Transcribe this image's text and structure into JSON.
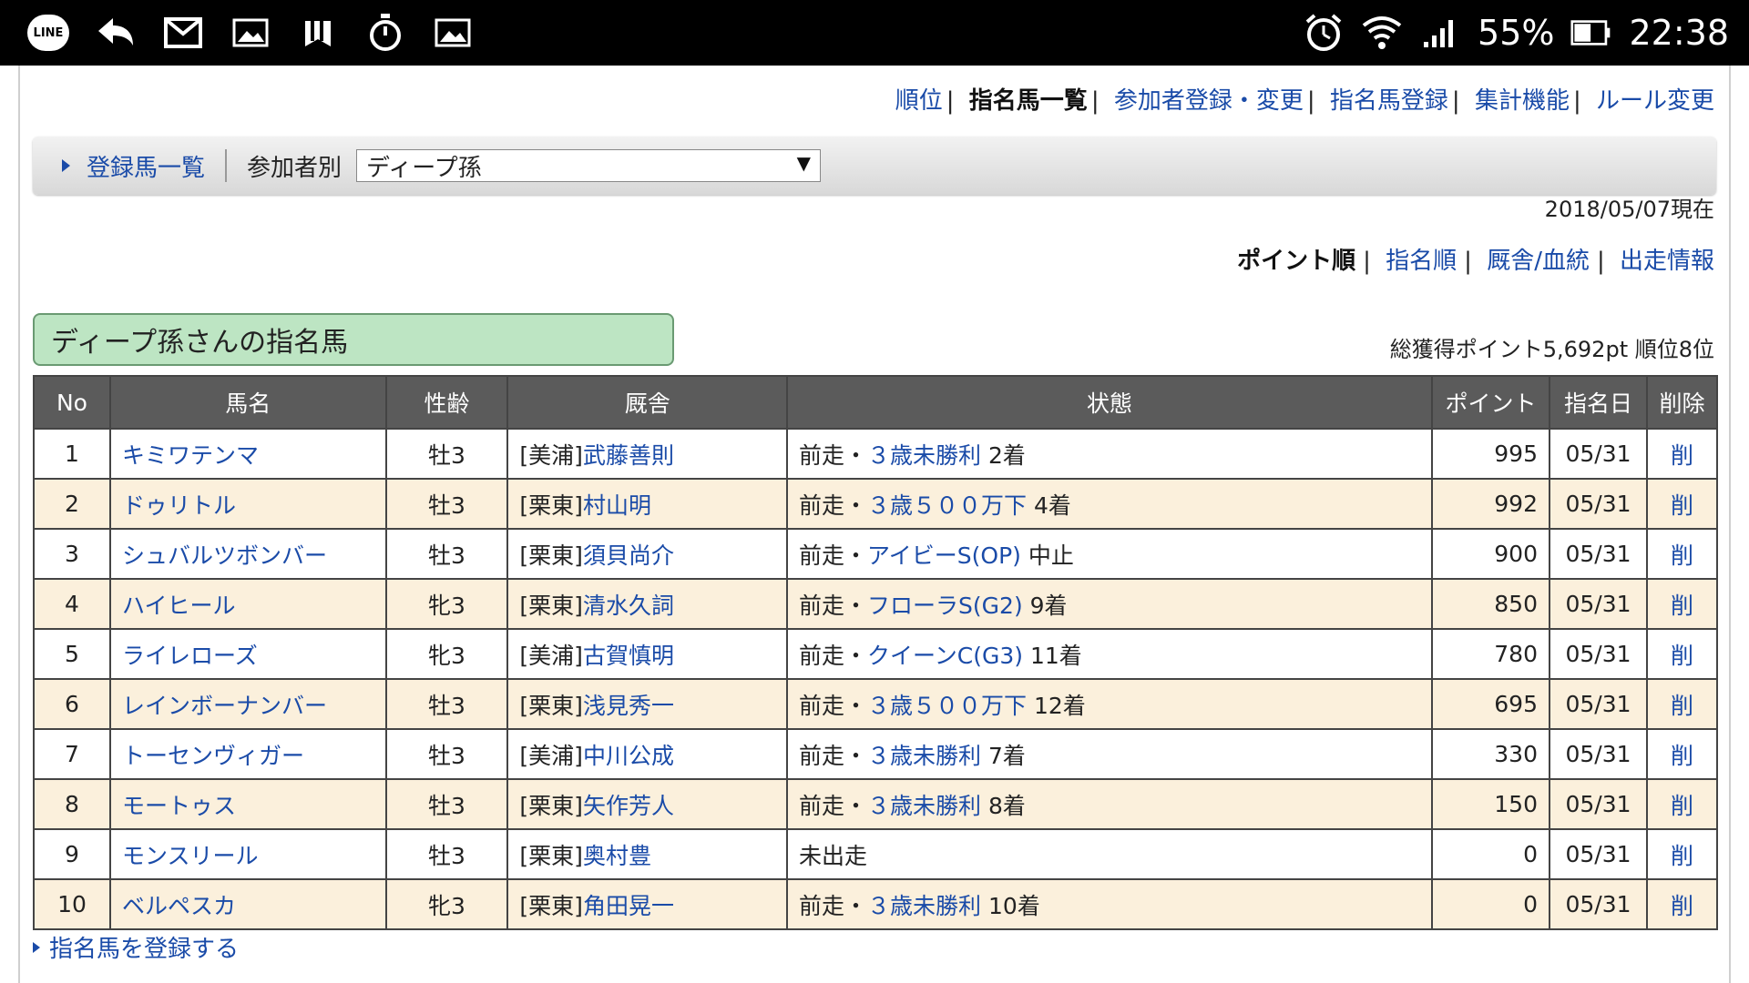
{
  "statusbar": {
    "line_label": "LINE",
    "battery": "55%",
    "time": "22:38",
    "icons": [
      "line-icon",
      "reply-icon",
      "gmail-icon",
      "image-icon",
      "bookmark-icon",
      "stopwatch-icon",
      "image-icon",
      "alarm-icon",
      "wifi-icon",
      "signal-icon",
      "battery-icon"
    ]
  },
  "topnav": {
    "items": [
      {
        "label": "順位",
        "current": false
      },
      {
        "label": "指名馬一覧",
        "current": true
      },
      {
        "label": "参加者登録・変更",
        "current": false
      },
      {
        "label": "指名馬登録",
        "current": false
      },
      {
        "label": "集計機能",
        "current": false
      },
      {
        "label": "ルール変更",
        "current": false
      }
    ]
  },
  "filter": {
    "link_label": "登録馬一覧",
    "participant_label": "参加者別",
    "selected": "ディープ孫"
  },
  "as_of": "2018/05/07現在",
  "sortnav": {
    "items": [
      {
        "label": "ポイント順",
        "current": true
      },
      {
        "label": "指名順",
        "current": false
      },
      {
        "label": "厩舎/血統",
        "current": false
      },
      {
        "label": "出走情報",
        "current": false
      }
    ]
  },
  "panel_title": "ディープ孫さんの指名馬",
  "totals": "総獲得ポイント5,692pt 順位8位",
  "table": {
    "headers": [
      "No",
      "馬名",
      "性齢",
      "厩舎",
      "状態",
      "ポイント",
      "指名日",
      "削除"
    ],
    "rows": [
      {
        "no": "1",
        "name": "キミワテンマ",
        "sexage": "牡3",
        "region": "[美浦]",
        "trainer": "武藤善則",
        "status_prefix": "前走・",
        "race": "３歳未勝利",
        "result": " 2着",
        "points": "995",
        "date": "05/31",
        "del": "削"
      },
      {
        "no": "2",
        "name": "ドゥリトル",
        "sexage": "牡3",
        "region": "[栗東]",
        "trainer": "村山明",
        "status_prefix": "前走・",
        "race": "３歳５００万下",
        "result": " 4着",
        "points": "992",
        "date": "05/31",
        "del": "削"
      },
      {
        "no": "3",
        "name": "シュバルツボンバー",
        "sexage": "牡3",
        "region": "[栗東]",
        "trainer": "須貝尚介",
        "status_prefix": "前走・",
        "race": "アイビーS(OP)",
        "result": " 中止",
        "points": "900",
        "date": "05/31",
        "del": "削"
      },
      {
        "no": "4",
        "name": "ハイヒール",
        "sexage": "牝3",
        "region": "[栗東]",
        "trainer": "清水久詞",
        "status_prefix": "前走・",
        "race": "フローラS(G2)",
        "result": " 9着",
        "points": "850",
        "date": "05/31",
        "del": "削"
      },
      {
        "no": "5",
        "name": "ライレローズ",
        "sexage": "牝3",
        "region": "[美浦]",
        "trainer": "古賀慎明",
        "status_prefix": "前走・",
        "race": "クイーンC(G3)",
        "result": " 11着",
        "points": "780",
        "date": "05/31",
        "del": "削"
      },
      {
        "no": "6",
        "name": "レインボーナンバー",
        "sexage": "牡3",
        "region": "[栗東]",
        "trainer": "浅見秀一",
        "status_prefix": "前走・",
        "race": "３歳５００万下",
        "result": " 12着",
        "points": "695",
        "date": "05/31",
        "del": "削"
      },
      {
        "no": "7",
        "name": "トーセンヴィガー",
        "sexage": "牡3",
        "region": "[美浦]",
        "trainer": "中川公成",
        "status_prefix": "前走・",
        "race": "３歳未勝利",
        "result": " 7着",
        "points": "330",
        "date": "05/31",
        "del": "削"
      },
      {
        "no": "8",
        "name": "モートゥス",
        "sexage": "牡3",
        "region": "[栗東]",
        "trainer": "矢作芳人",
        "status_prefix": "前走・",
        "race": "３歳未勝利",
        "result": " 8着",
        "points": "150",
        "date": "05/31",
        "del": "削"
      },
      {
        "no": "9",
        "name": "モンスリール",
        "sexage": "牡3",
        "region": "[栗東]",
        "trainer": "奥村豊",
        "status_prefix": "未出走",
        "race": "",
        "result": "",
        "points": "0",
        "date": "05/31",
        "del": "削"
      },
      {
        "no": "10",
        "name": "ベルペスカ",
        "sexage": "牝3",
        "region": "[栗東]",
        "trainer": "角田晃一",
        "status_prefix": "前走・",
        "race": "３歳未勝利",
        "result": " 10着",
        "points": "0",
        "date": "05/31",
        "del": "削"
      }
    ]
  },
  "register_link": "指名馬を登録する"
}
